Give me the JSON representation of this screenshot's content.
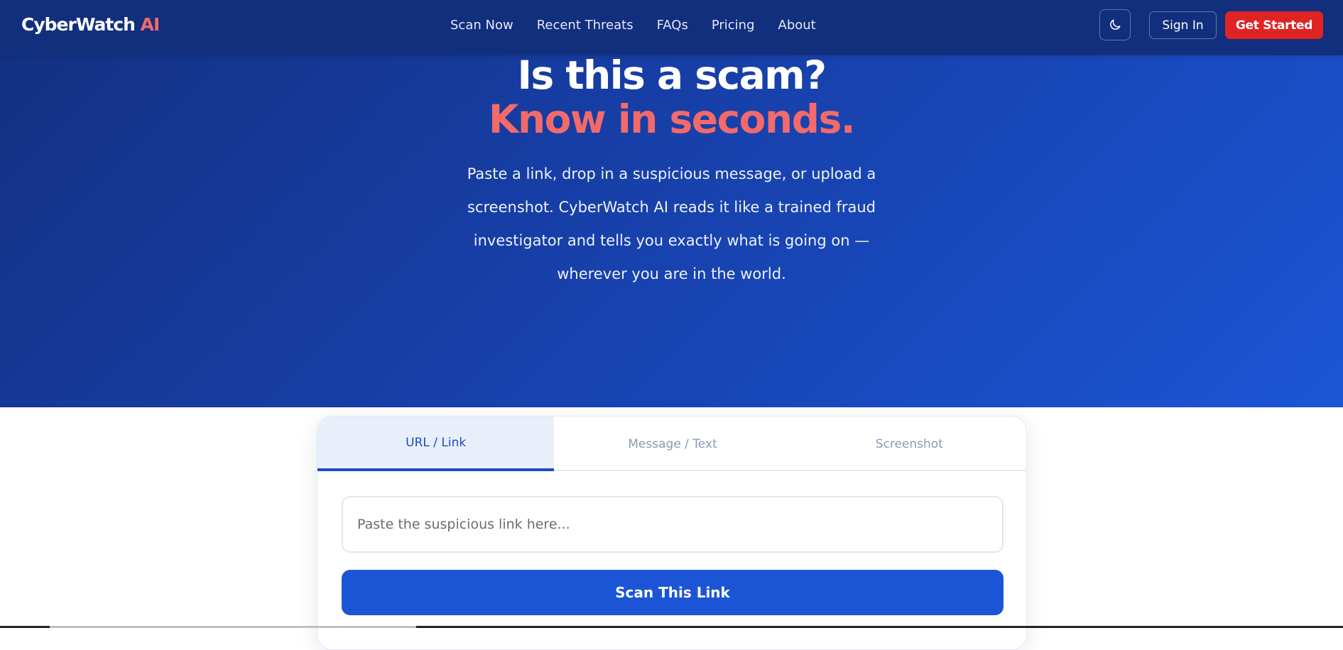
{
  "brand": {
    "name": "CyberWatch",
    "suffix": "AI"
  },
  "nav": {
    "items": [
      {
        "label": "Scan Now"
      },
      {
        "label": "Recent Threats"
      },
      {
        "label": "FAQs"
      },
      {
        "label": "Pricing"
      },
      {
        "label": "About"
      }
    ],
    "theme_toggle_icon": "moon-icon",
    "sign_in_label": "Sign In",
    "get_started_label": "Get Started"
  },
  "hero": {
    "headline_line1": "Is this a scam?",
    "headline_line2": "Know in seconds.",
    "description": "Paste a link, drop in a suspicious message, or upload a screenshot. CyberWatch AI reads it like a trained fraud investigator and tells you exactly what is going on — wherever you are in the world."
  },
  "scanner": {
    "tabs": [
      {
        "label": "URL / Link",
        "active": true
      },
      {
        "label": "Message / Text",
        "active": false
      },
      {
        "label": "Screenshot",
        "active": false
      }
    ],
    "input": {
      "value": "",
      "placeholder": "Paste the suspicious link here..."
    },
    "submit_label": "Scan This Link"
  },
  "colors": {
    "nav_bg": "#122f7e",
    "hero_gradient_start": "#12307f",
    "hero_gradient_end": "#1b55d6",
    "accent_red": "#e02424",
    "headline_accent": "#f26a6a",
    "primary_blue": "#1b55d6",
    "active_tab_text": "#1c4cc0"
  }
}
